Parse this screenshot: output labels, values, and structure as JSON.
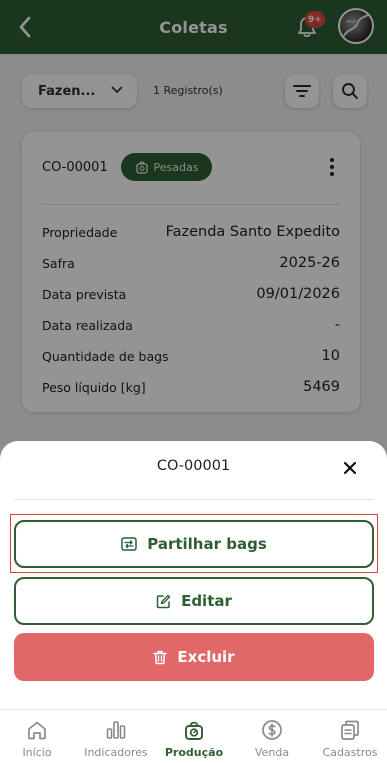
{
  "header": {
    "title": "Coletas",
    "notification_count": "9+"
  },
  "toolbar": {
    "farm_filter_value": "Fazen...",
    "records_text": "1 Registro(s)"
  },
  "card": {
    "code": "CO-00001",
    "status_chip": "Pesadas",
    "rows": [
      {
        "label": "Propriedade",
        "value": "Fazenda Santo Expedito"
      },
      {
        "label": "Safra",
        "value": "2025-26"
      },
      {
        "label": "Data prevista",
        "value": "09/01/2026"
      },
      {
        "label": "Data realizada",
        "value": "-"
      },
      {
        "label": "Quantidade de bags",
        "value": "10"
      },
      {
        "label": "Peso líquido [kg]",
        "value": "5469"
      }
    ]
  },
  "sheet": {
    "title": "CO-00001",
    "share_label": "Partilhar bags",
    "edit_label": "Editar",
    "delete_label": "Excluir"
  },
  "bottom_nav": {
    "items": [
      {
        "label": "Início",
        "icon": "home-icon",
        "active": false
      },
      {
        "label": "Indicadores",
        "icon": "bar-chart-icon",
        "active": false
      },
      {
        "label": "Produção",
        "icon": "scale-icon",
        "active": true
      },
      {
        "label": "Venda",
        "icon": "dollar-icon",
        "active": false
      },
      {
        "label": "Cadastros",
        "icon": "copy-icon",
        "active": false
      }
    ]
  },
  "colors": {
    "primary": "#2f5e35",
    "danger": "#e06868",
    "badge": "#e0483e",
    "highlight": "#e03c3c"
  }
}
